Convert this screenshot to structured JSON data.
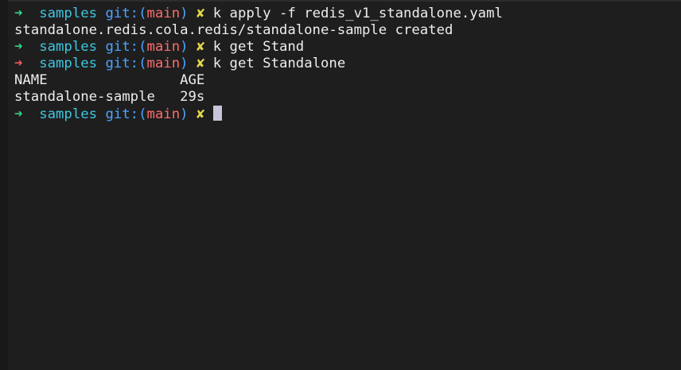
{
  "colors": {
    "background": "#1e1e1e",
    "prompt_arrow_success": "#2fd38a",
    "prompt_arrow_error": "#ef5b5b",
    "directory": "#3ec6e0",
    "git_label": "#4ea3ff",
    "branch": "#ff6b6b",
    "dirty_marker": "#e6d84a",
    "text": "#ededed",
    "cursor": "#c9c4d8"
  },
  "prompt": {
    "arrow": "➜",
    "directory": "samples",
    "git_prefix": "git:(",
    "branch": "main",
    "git_suffix": ")",
    "dirty_marker": "✘"
  },
  "lines": [
    {
      "type": "prompt",
      "status": "success",
      "command": "k apply -f redis_v1_standalone.yaml"
    },
    {
      "type": "output",
      "text": "standalone.redis.cola.redis/standalone-sample created"
    },
    {
      "type": "prompt",
      "status": "success",
      "command": "k get Stand"
    },
    {
      "type": "prompt",
      "status": "error",
      "command": "k get Standalone"
    },
    {
      "type": "output",
      "text": "NAME                AGE"
    },
    {
      "type": "output",
      "text": "standalone-sample   29s"
    },
    {
      "type": "prompt",
      "status": "success",
      "command": ""
    }
  ]
}
